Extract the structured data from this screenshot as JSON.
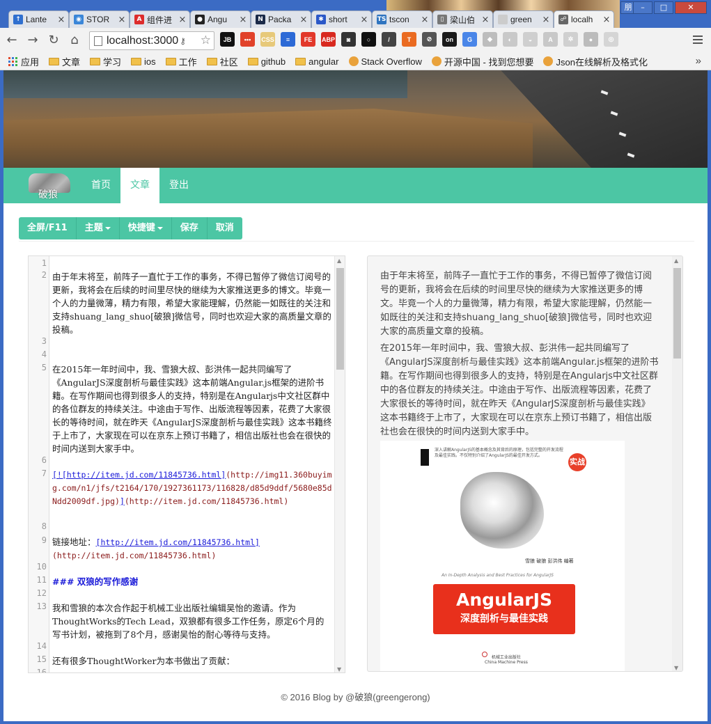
{
  "window": {
    "profile_label": "朋",
    "min_label": "–",
    "max_label": "□",
    "close_label": "✕"
  },
  "tabs": [
    {
      "title": "Lante",
      "icon": "lantern-icon",
      "color": "#2f6fcf",
      "glyph": "↑"
    },
    {
      "title": "STOR",
      "icon": "globe-icon",
      "color": "#3a86d8",
      "glyph": "◉"
    },
    {
      "title": "组件进",
      "icon": "angular-icon",
      "color": "#dd2c2c",
      "glyph": "A"
    },
    {
      "title": "Angu",
      "icon": "github-icon",
      "color": "#222222",
      "glyph": "●"
    },
    {
      "title": "Packa",
      "icon": "npm-icon",
      "color": "#1b2a48",
      "glyph": "N"
    },
    {
      "title": "short",
      "icon": "paw-icon",
      "color": "#2b58c8",
      "glyph": "✱"
    },
    {
      "title": "tscon",
      "icon": "typescript-icon",
      "color": "#2f74c0",
      "glyph": "TS"
    },
    {
      "title": "梁山伯",
      "icon": "document-icon",
      "color": "#777777",
      "glyph": "▯"
    },
    {
      "title": "green",
      "icon": "blank-tab-icon",
      "color": "#cccccc",
      "glyph": ""
    },
    {
      "title": "localh",
      "icon": "local-server-icon",
      "color": "#666666",
      "glyph": "☍",
      "active": true
    }
  ],
  "toolbar": {
    "url": "localhost:3000",
    "back_glyph": "←",
    "forward_glyph": "→",
    "reload_glyph": "↻",
    "home_glyph": "⌂",
    "star_glyph": "☆",
    "extensions": [
      {
        "name": "jetbrains-icon",
        "label": "JB",
        "color": "#111111"
      },
      {
        "name": "dots-icon",
        "label": "•••",
        "color": "#e1422a"
      },
      {
        "name": "css-icon",
        "label": "CSS",
        "color": "#e7c97a"
      },
      {
        "name": "notes-icon",
        "label": "≡",
        "color": "#2d6ad6"
      },
      {
        "name": "fe-icon",
        "label": "FE",
        "color": "#e2382a"
      },
      {
        "name": "adblock-icon",
        "label": "ABP",
        "color": "#d8291f"
      },
      {
        "name": "camera-icon",
        "label": "◙",
        "color": "#333333"
      },
      {
        "name": "ring-icon",
        "label": "○",
        "color": "#111111"
      },
      {
        "name": "eyedropper-icon",
        "label": "/",
        "color": "#444444"
      },
      {
        "name": "t-icon",
        "label": "T",
        "color": "#ea6b21"
      },
      {
        "name": "nosleep-icon",
        "label": "⊘",
        "color": "#555555"
      },
      {
        "name": "on-icon",
        "label": "on",
        "color": "#1a1a1a"
      },
      {
        "name": "translate-icon",
        "label": "G",
        "color": "#4a86e8"
      },
      {
        "name": "grey-ext-1-icon",
        "label": "◆",
        "color": "#bdbdbd"
      },
      {
        "name": "grey-ext-2-icon",
        "label": "◐",
        "color": "#c9c9c9"
      },
      {
        "name": "grey-ext-3-icon",
        "label": "◒",
        "color": "#cfcfcf"
      },
      {
        "name": "grey-angular-icon",
        "label": "A",
        "color": "#c8c8c8"
      },
      {
        "name": "grey-react-icon",
        "label": "✲",
        "color": "#d0d0d0"
      },
      {
        "name": "grey-ext-4-icon",
        "label": "●",
        "color": "#bcbcbc"
      },
      {
        "name": "grey-ext-5-icon",
        "label": "◎",
        "color": "#d5d5d5"
      }
    ]
  },
  "bookmarks": {
    "apps_label": "应用",
    "items": [
      {
        "label": "文章",
        "type": "folder"
      },
      {
        "label": "学习",
        "type": "folder"
      },
      {
        "label": "ios",
        "type": "folder"
      },
      {
        "label": "工作",
        "type": "folder"
      },
      {
        "label": "社区",
        "type": "folder"
      },
      {
        "label": "github",
        "type": "folder"
      },
      {
        "label": "angular",
        "type": "folder"
      },
      {
        "label": "Stack Overflow",
        "type": "link"
      },
      {
        "label": "开源中国 - 找到您想要",
        "type": "link"
      },
      {
        "label": "Json在线解析及格式化",
        "type": "link"
      }
    ],
    "more_glyph": "»"
  },
  "site": {
    "brand_name": "破狼",
    "nav": [
      {
        "label": "首页",
        "active": false
      },
      {
        "label": "文章",
        "active": true
      },
      {
        "label": "登出",
        "active": false
      }
    ],
    "actions": {
      "fullscreen": "全屏/F11",
      "theme": "主题",
      "shortcuts": "快捷键",
      "save": "保存",
      "cancel": "取消"
    }
  },
  "editor": {
    "line_numbers": [
      "1",
      "2",
      "3",
      "4",
      "5",
      "6",
      "7",
      "8",
      "9",
      "10",
      "11",
      "12",
      "13",
      "14",
      "15",
      "16"
    ],
    "lines": {
      "l2": "由于年末将至，前阵子一直忙于工作的事务，不得已暂停了微信订阅号的更新，我将会在后续的时间里尽快的继续为大家推送更多的博文。毕竟一个人的力量微薄，精力有限，希望大家能理解，仍然能一如既往的关注和支持shuang_lang_shuo[破狼]微信号，同时也欢迎大家的高质量文章的投稿。",
      "l5": "在2015年一年时间中，我、雪狼大叔、彭洪伟一起共同编写了《AngularJS深度剖析与最佳实践》这本前端Angular.js框架的进阶书籍。在写作期间也得到很多人的支持，特别是在Angularjs中文社区群中的各位群友的持续关注。中途由于写作、出版流程等因素，花费了大家很长的等待时间，就在昨天《AngularJS深度剖析与最佳实践》这本书籍终于上市了，大家现在可以在京东上预订书籍了，相信出版社也会在很快的时间内送到大家手中。",
      "l7_link": "[![http://item.jd.com/11845736.html]",
      "l7_img": "(http://img11.360buyimg.com/n1/jfs/t2164/170/1927361173/116828/d85d9ddf/5680e85dNdd2009df.jpg)",
      "l7_close": "]",
      "l7_url": "(http://item.jd.com/11845736.html)",
      "l9_label": "链接地址：",
      "l9_link": "[http://item.jd.com/11845736.html]",
      "l9_url": "(http://item.jd.com/11845736.html)",
      "l11": "### 双狼的写作感谢",
      "l13": "我和雪狼的本次合作起于机械工业出版社编辑吴怡的邀请。作为ThoughtWorks的Tech Lead，双狼都有很多工作任务，原定6个月的写书计划，被拖到了8个月，感谢吴怡的耐心等待与支持。",
      "l15": "还有很多ThoughtWorker为本书做出了贡献："
    }
  },
  "preview": {
    "p1": "由于年末将至，前阵子一直忙于工作的事务，不得已暂停了微信订阅号的更新，我将会在后续的时间里尽快的继续为大家推送更多的博文。毕竟一个人的力量微薄，精力有限，希望大家能理解，仍然能一如既往的关注和支持shuang_lang_shuo[破狼]微信号，同时也欢迎大家的高质量文章的投稿。",
    "p2": "在2015年一年时间中，我、雪狼大叔、彭洪伟一起共同编写了《AngularJS深度剖析与最佳实践》这本前端Angular.js框架的进阶书籍。在写作期间也得到很多人的支持，特别是在Angularjs中文社区群中的各位群友的持续关注。中途由于写作、出版流程等因素，花费了大家很长的等待时间，就在昨天《AngularJS深度剖析与最佳实践》这本书籍终于上市了，大家现在可以在京东上预订书籍了，相信出版社也会在很快的时间内送到大家手中。",
    "book": {
      "blurb": "深入讲解AngularJS的基本概念及其背后的原理，包括完整的开发流程及最佳实践。不仅特别介绍了AngularJS的最佳开发方式。",
      "seal": "实战",
      "authors": "雪狼 破狼 彭洪伟 编著",
      "english_title": "An In-Depth Analysis and Best Practices for AngularJS",
      "title_en": "AngularJS",
      "title_cn": "深度剖析与最佳实践",
      "publisher_cn": "机械工业出版社",
      "publisher_en": "China Machine Press"
    }
  },
  "footer": "© 2016 Blog by @破狼(greengerong)",
  "colors": {
    "accent": "#4cc6a4",
    "chrome_frame": "#3b6bc4",
    "link": "#1a1ad8",
    "book_red": "#e8301c"
  }
}
